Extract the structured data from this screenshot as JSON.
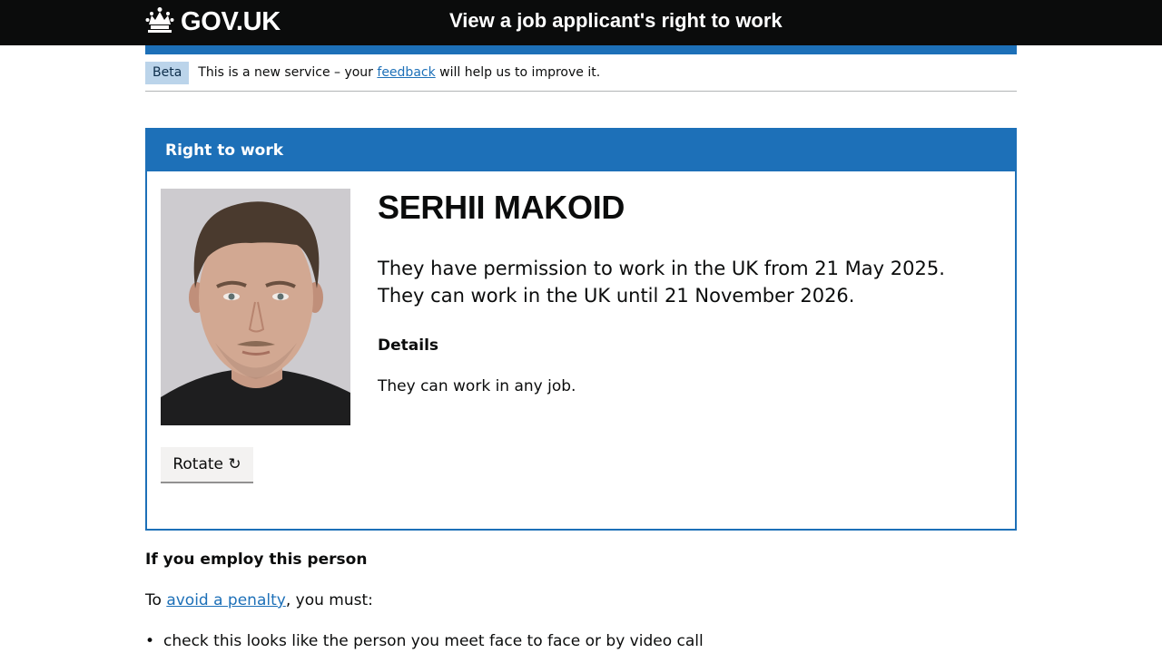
{
  "header": {
    "logo_text": "GOV.UK",
    "service_name": "View a job applicant's right to work"
  },
  "phase_banner": {
    "tag": "Beta",
    "text_before": "This is a new service – your ",
    "link": "feedback",
    "text_after": " will help us to improve it."
  },
  "panel": {
    "title": "Right to work",
    "name": "SERHII MAKOID",
    "permission_line_1": "They have permission to work in the UK from 21 May 2025.",
    "permission_line_2": "They can work in the UK until 21 November 2026.",
    "details_heading": "Details",
    "details_text": "They can work in any job.",
    "rotate_label": "Rotate ↻"
  },
  "employ": {
    "heading": "If you employ this person",
    "intro_before": "To ",
    "intro_link": "avoid a penalty",
    "intro_after": ", you must:",
    "bullets": [
      "check this looks like the person you meet face to face or by video call"
    ]
  },
  "colors": {
    "header_bg": "#0b0c0c",
    "brand_blue": "#1d70b8",
    "beta_tag_bg": "#bbd4ea"
  }
}
